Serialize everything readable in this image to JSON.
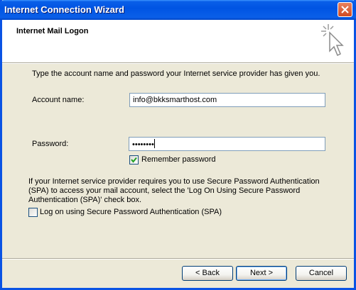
{
  "window": {
    "title": "Internet Connection Wizard"
  },
  "header": {
    "title": "Internet Mail Logon"
  },
  "instruction": "Type the account name and password your Internet service provider has given you.",
  "account": {
    "label": "Account name:",
    "value": "info@bkksmarthost.com"
  },
  "password": {
    "label": "Password:",
    "masked_value": "••••••••"
  },
  "remember": {
    "label": "Remember password",
    "checked": true
  },
  "spa": {
    "description_line1": "If your Internet service provider requires you to use Secure Password Authentication",
    "description_line2": "(SPA) to access your mail account, select the 'Log On Using Secure Password",
    "description_line3": "Authentication (SPA)' check box.",
    "checkbox_label": "Log on using Secure Password Authentication (SPA)",
    "checked": false
  },
  "buttons": {
    "back": "< Back",
    "next": "Next >",
    "cancel": "Cancel"
  },
  "colors": {
    "titlebar": "#0054e3",
    "dialog_bg": "#ece9d8",
    "input_border": "#7f9db9"
  },
  "icons": {
    "close": "close-icon",
    "wizard": "wizard-sparkle-cursor-icon",
    "check": "checkmark-icon"
  }
}
